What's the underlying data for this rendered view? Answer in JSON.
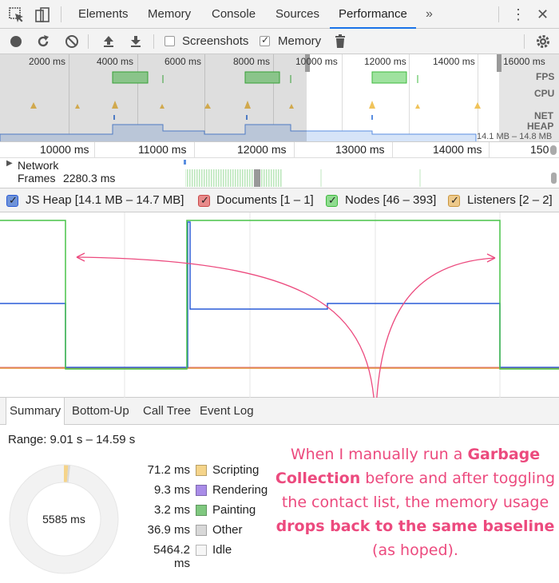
{
  "tabs": {
    "elements": "Elements",
    "memory": "Memory",
    "console": "Console",
    "sources": "Sources",
    "performance": "Performance",
    "more": "»"
  },
  "toolbar": {
    "screenshots_label": "Screenshots",
    "screenshots_checked": false,
    "memory_label": "Memory",
    "memory_checked": true
  },
  "overview": {
    "ticks": [
      "2000 ms",
      "4000 ms",
      "6000 ms",
      "8000 ms",
      "10000 ms",
      "12000 ms",
      "14000 ms",
      "16000 ms"
    ],
    "rows": [
      "FPS",
      "CPU",
      "NET",
      "HEAP"
    ],
    "heap_range": "14.1 MB – 14.8 MB"
  },
  "ruler": {
    "ticks": [
      "10000 ms",
      "11000 ms",
      "12000 ms",
      "13000 ms",
      "14000 ms",
      "150"
    ]
  },
  "tracks": {
    "network": "Network",
    "frames_label": "Frames",
    "frames_value": "2280.3 ms"
  },
  "legend": {
    "js_heap": "JS Heap [14.1 MB – 14.7 MB]",
    "documents": "Documents [1 – 1]",
    "nodes": "Nodes [46 – 393]",
    "listeners": "Listeners [2 – 2]",
    "colors": {
      "js_heap": "#2a5bd7",
      "documents": "#e57373",
      "nodes": "#5ecb5e",
      "listeners": "#e8b86a"
    }
  },
  "bottom_tabs": {
    "summary": "Summary",
    "bottom_up": "Bottom-Up",
    "call_tree": "Call Tree",
    "event_log": "Event Log"
  },
  "summary": {
    "range": "Range: 9.01 s – 14.59 s",
    "total": "5585 ms",
    "items": [
      {
        "value": "71.2 ms",
        "label": "Scripting",
        "color": "#f5d48a"
      },
      {
        "value": "9.3 ms",
        "label": "Rendering",
        "color": "#a98ce8"
      },
      {
        "value": "3.2 ms",
        "label": "Painting",
        "color": "#7fc87f"
      },
      {
        "value": "36.9 ms",
        "label": "Other",
        "color": "#d8d8d8"
      },
      {
        "value": "5464.2 ms",
        "label": "Idle",
        "color": "#f6f6f6"
      }
    ]
  },
  "annotation": {
    "part1": "When I manually run a ",
    "bold1": "Garbage Collection",
    "part2": " before and after toggling the contact list, the memory usage ",
    "bold2": "drops back to the same baseline",
    "part3": " (as hoped)."
  }
}
